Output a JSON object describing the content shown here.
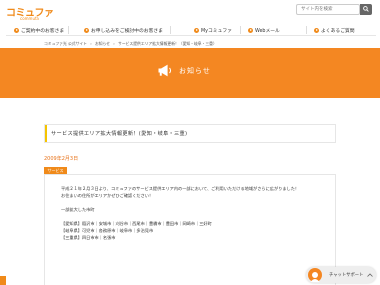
{
  "header": {
    "logo_text": "コミュファ",
    "logo_sub": "commufa",
    "search_placeholder": "サイト内を検索"
  },
  "gnav": {
    "items": [
      {
        "label": "ご契約中のお客さま"
      },
      {
        "label": "お申し込みをご検討中のお客さま"
      },
      {
        "label": "Myコミュファ"
      },
      {
        "label": "Webメール"
      },
      {
        "label": "よくあるご質問"
      }
    ]
  },
  "breadcrumb": {
    "items": [
      "コミュファ光 公式サイト",
      "›",
      "お知らせ",
      "›",
      "サービス提供エリア拡大情報更新！（愛知・岐阜・三重）"
    ]
  },
  "hero": {
    "title": "お知らせ",
    "icon": "megaphone-icon"
  },
  "article": {
    "title": "サービス提供エリア拡大情報更新！(愛知・岐阜・三重)",
    "date": "2009年2月3日",
    "tag": "サービス",
    "paragraphs": [
      "平成２１年２月３日より、コミュファのサービス提供エリア内の一部において、ご利用いただける地域がさらに広がりました！",
      "お住まいの住所がエリアかぜひご確認ください！",
      "",
      "一部拡大した市町",
      "",
      "【愛知県】稲沢市｜安城市｜刈谷市｜西尾市｜豊橋市｜豊田市｜岡崎市｜三好町",
      "【岐阜県】可児市｜各務原市｜岐阜市｜多治見市",
      "【三重県】四日市市｜名張市"
    ]
  },
  "chat": {
    "label": "チャットサポート"
  },
  "colors": {
    "brand_orange": "#f48722",
    "accent_yellow": "#f5c400",
    "date_orange": "#e8731a"
  }
}
